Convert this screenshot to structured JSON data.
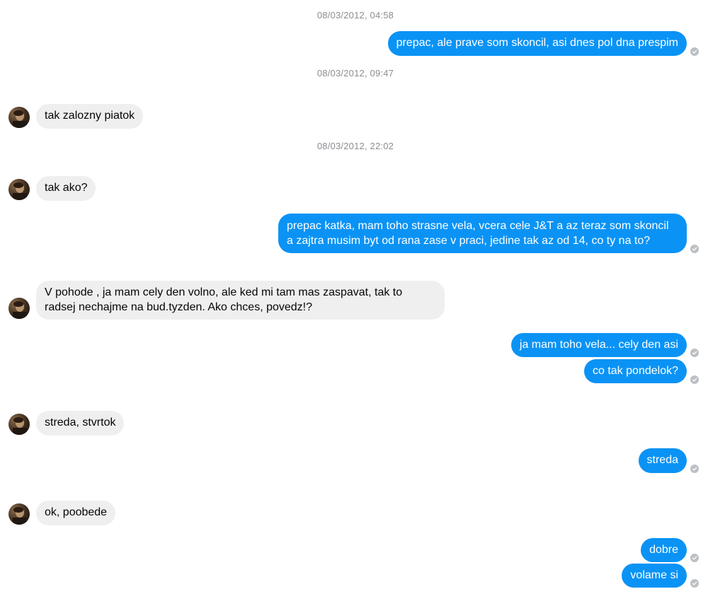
{
  "conversation": {
    "timestamps": [
      "08/03/2012, 04:58",
      "08/03/2012, 09:47",
      "08/03/2012, 22:02"
    ],
    "messages": [
      {
        "direction": "out",
        "text": "prepac, ale prave som skoncil, asi dnes pol dna prespim"
      },
      {
        "direction": "in",
        "text": "tak zalozny piatok"
      },
      {
        "direction": "in",
        "text": "tak ako?"
      },
      {
        "direction": "out",
        "lines": [
          "prepac katka, mam toho strasne vela, vcera cele J&T a az teraz som skoncil",
          "a zajtra musim byt od rana zase v praci, jedine tak az od 14, co ty na to?"
        ]
      },
      {
        "direction": "in",
        "lines": [
          "V pohode , ja mam cely den volno, ale ked mi tam mas zaspavat, tak to",
          "radsej nechajme na bud.tyzden. Ako chces, povedz!?"
        ]
      },
      {
        "direction": "out",
        "text": "ja mam toho vela... cely den asi"
      },
      {
        "direction": "out",
        "text": "co tak pondelok?"
      },
      {
        "direction": "in",
        "text": "streda, stvrtok"
      },
      {
        "direction": "out",
        "text": "streda"
      },
      {
        "direction": "in",
        "text": "ok, poobede"
      },
      {
        "direction": "out",
        "text": "dobre"
      },
      {
        "direction": "out",
        "text": "volame si"
      }
    ]
  },
  "colors": {
    "outgoing_bubble": "#0a93f5",
    "incoming_bubble": "#efefef",
    "timestamp_text": "#8a8d91",
    "read_check": "#bcc0c4"
  },
  "icons": {
    "avatar": "contact-avatar",
    "status": "sent-check-icon"
  }
}
